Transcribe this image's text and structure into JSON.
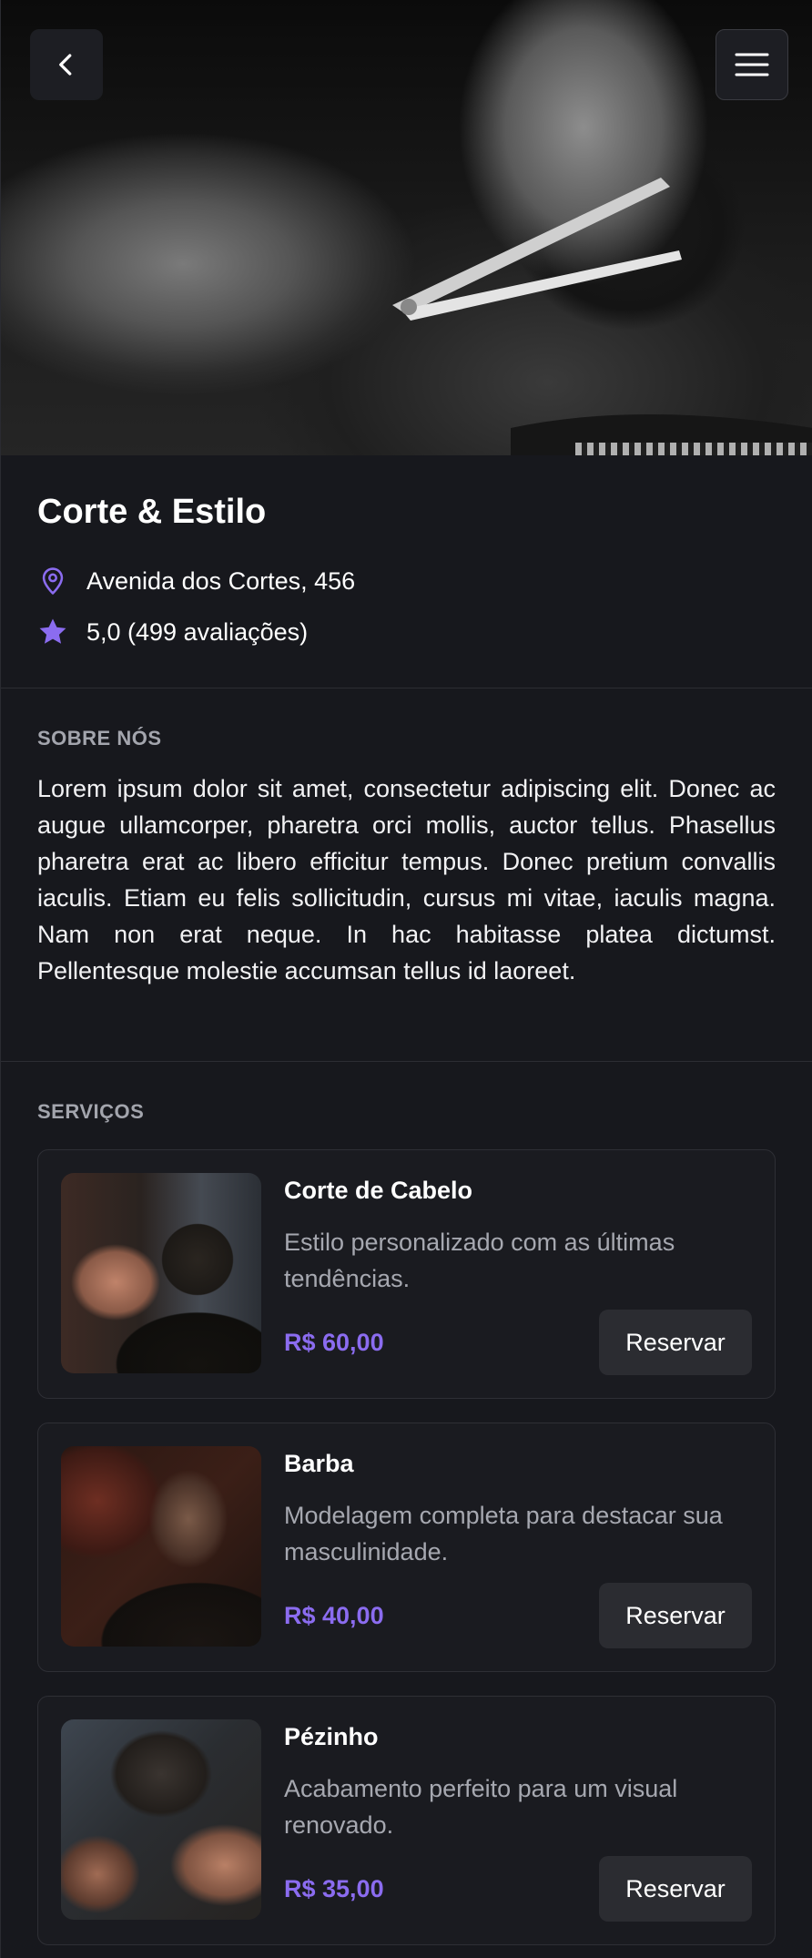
{
  "header": {
    "back_icon": "chevron-left-icon",
    "menu_icon": "hamburger-menu-icon"
  },
  "shop": {
    "name": "Corte & Estilo",
    "address": "Avenida dos Cortes, 456",
    "rating": "5,0 (499 avaliações)",
    "location_icon": "map-pin-icon",
    "rating_icon": "star-icon"
  },
  "about": {
    "label": "SOBRE NÓS",
    "text": "Lorem ipsum dolor sit amet, consectetur adipiscing elit. Donec ac augue ullamcorper, pharetra orci mollis, auctor tellus. Phasellus pharetra erat ac libero efficitur tempus. Donec pretium convallis iaculis. Etiam eu felis sollicitudin, cursus mi vitae, iaculis magna. Nam non erat neque. In hac habitasse platea dictumst. Pellentesque molestie accumsan tellus id laoreet."
  },
  "services": {
    "label": "SERVIÇOS",
    "items": [
      {
        "name": "Corte de Cabelo",
        "description": "Estilo personalizado com as últimas tendências.",
        "price": "R$ 60,00",
        "button": "Reservar"
      },
      {
        "name": "Barba",
        "description": "Modelagem completa para destacar sua masculinidade.",
        "price": "R$ 40,00",
        "button": "Reservar"
      },
      {
        "name": "Pézinho",
        "description": "Acabamento perfeito para um visual renovado.",
        "price": "R$ 35,00",
        "button": "Reservar"
      }
    ]
  },
  "colors": {
    "background": "#17181d",
    "accent": "#8b6cf0",
    "card": "#1a1b20",
    "muted_text": "#a6a8b0"
  }
}
